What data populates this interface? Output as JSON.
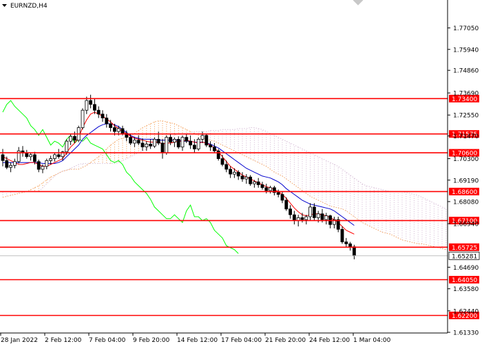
{
  "header": {
    "symbol": "EURNZD,H4",
    "menu_icon": "triangle-down-icon",
    "corner_icon": "chevron-down-icon"
  },
  "chart_data": {
    "type": "candlestick",
    "title": "EURNZD,H4",
    "ylim": [
      1.6133,
      1.7835
    ],
    "y_ticks": [
      1.7705,
      1.7594,
      1.7486,
      1.7369,
      1.7255,
      1.7147,
      1.703,
      1.6919,
      1.6808,
      1.6694,
      1.6469,
      1.6358,
      1.6244,
      1.6133
    ],
    "y_tick_labels": [
      "1.77050",
      "1.75940",
      "1.74860",
      "1.73690",
      "1.72550",
      "1.71470",
      "1.70300",
      "1.69190",
      "1.68080",
      "1.66940",
      "1.64690",
      "1.63580",
      "1.62440",
      "1.61330"
    ],
    "x_tick_labels": [
      "28 Jan 2022",
      "2 Feb 12:00",
      "7 Feb 04:00",
      "9 Feb 20:00",
      "14 Feb 12:00",
      "17 Feb 04:00",
      "21 Feb 20:00",
      "24 Feb 12:00",
      "1 Mar 04:00"
    ],
    "levels": [
      {
        "label": "1.73400",
        "value": 1.734
      },
      {
        "label": "1.71575",
        "value": 1.71575
      },
      {
        "label": "1.70600",
        "value": 1.706
      },
      {
        "label": "1.68600",
        "value": 1.686
      },
      {
        "label": "1.67100",
        "value": 1.671
      },
      {
        "label": "1.65725",
        "value": 1.65725
      },
      {
        "label": "1.64050",
        "value": 1.6405
      },
      {
        "label": "1.62200",
        "value": 1.622
      }
    ],
    "current_price": {
      "label": "1.65281",
      "value": 1.65281
    },
    "candles": [
      [
        1.705,
        1.708,
        1.699,
        1.702
      ],
      [
        1.702,
        1.704,
        1.6975,
        1.6985
      ],
      [
        1.6985,
        1.701,
        1.696,
        1.6995
      ],
      [
        1.6995,
        1.703,
        1.698,
        1.7015
      ],
      [
        1.7015,
        1.709,
        1.7005,
        1.707
      ],
      [
        1.707,
        1.7095,
        1.704,
        1.706
      ],
      [
        1.706,
        1.7075,
        1.703,
        1.704
      ],
      [
        1.704,
        1.706,
        1.702,
        1.705
      ],
      [
        1.705,
        1.7065,
        1.7,
        1.7015
      ],
      [
        1.7015,
        1.7025,
        1.696,
        1.6975
      ],
      [
        1.6975,
        1.7,
        1.6955,
        1.699
      ],
      [
        1.699,
        1.703,
        1.6975,
        1.702
      ],
      [
        1.702,
        1.7045,
        1.7,
        1.703
      ],
      [
        1.703,
        1.706,
        1.7015,
        1.705
      ],
      [
        1.705,
        1.708,
        1.703,
        1.704
      ],
      [
        1.704,
        1.707,
        1.702,
        1.7065
      ],
      [
        1.7065,
        1.713,
        1.705,
        1.712
      ],
      [
        1.712,
        1.716,
        1.71,
        1.7145
      ],
      [
        1.7145,
        1.717,
        1.711,
        1.7125
      ],
      [
        1.7125,
        1.72,
        1.7115,
        1.719
      ],
      [
        1.719,
        1.729,
        1.718,
        1.728
      ],
      [
        1.728,
        1.735,
        1.726,
        1.733
      ],
      [
        1.733,
        1.736,
        1.729,
        1.731
      ],
      [
        1.731,
        1.734,
        1.726,
        1.728
      ],
      [
        1.728,
        1.73,
        1.724,
        1.726
      ],
      [
        1.726,
        1.728,
        1.722,
        1.724
      ],
      [
        1.724,
        1.726,
        1.719,
        1.721
      ],
      [
        1.721,
        1.723,
        1.717,
        1.719
      ],
      [
        1.719,
        1.721,
        1.715,
        1.717
      ],
      [
        1.717,
        1.72,
        1.715,
        1.7185
      ],
      [
        1.7185,
        1.72,
        1.715,
        1.716
      ],
      [
        1.716,
        1.7175,
        1.712,
        1.714
      ],
      [
        1.714,
        1.716,
        1.71,
        1.711
      ],
      [
        1.711,
        1.714,
        1.709,
        1.7125
      ],
      [
        1.7125,
        1.715,
        1.71,
        1.711
      ],
      [
        1.711,
        1.7135,
        1.707,
        1.709
      ],
      [
        1.709,
        1.712,
        1.707,
        1.7105
      ],
      [
        1.7105,
        1.713,
        1.708,
        1.7095
      ],
      [
        1.7095,
        1.714,
        1.7085,
        1.713
      ],
      [
        1.713,
        1.717,
        1.71,
        1.711
      ],
      [
        1.711,
        1.713,
        1.703,
        1.706
      ],
      [
        1.706,
        1.715,
        1.705,
        1.714
      ],
      [
        1.714,
        1.716,
        1.71,
        1.7115
      ],
      [
        1.7115,
        1.714,
        1.709,
        1.713
      ],
      [
        1.713,
        1.7145,
        1.708,
        1.709
      ],
      [
        1.709,
        1.715,
        1.707,
        1.714
      ],
      [
        1.714,
        1.716,
        1.711,
        1.712
      ],
      [
        1.712,
        1.715,
        1.708,
        1.71
      ],
      [
        1.71,
        1.713,
        1.706,
        1.708
      ],
      [
        1.708,
        1.714,
        1.707,
        1.713
      ],
      [
        1.713,
        1.717,
        1.711,
        1.715
      ],
      [
        1.715,
        1.716,
        1.709,
        1.71
      ],
      [
        1.71,
        1.712,
        1.707,
        1.709
      ],
      [
        1.709,
        1.711,
        1.706,
        1.707
      ],
      [
        1.707,
        1.708,
        1.702,
        1.703
      ],
      [
        1.703,
        1.705,
        1.699,
        1.7
      ],
      [
        1.7,
        1.702,
        1.696,
        1.6975
      ],
      [
        1.6975,
        1.699,
        1.693,
        1.695
      ],
      [
        1.695,
        1.698,
        1.693,
        1.696
      ],
      [
        1.696,
        1.697,
        1.692,
        1.694
      ],
      [
        1.694,
        1.696,
        1.691,
        1.6925
      ],
      [
        1.6925,
        1.695,
        1.69,
        1.6935
      ],
      [
        1.6935,
        1.6945,
        1.689,
        1.69
      ],
      [
        1.69,
        1.692,
        1.688,
        1.691
      ],
      [
        1.691,
        1.693,
        1.688,
        1.6895
      ],
      [
        1.6895,
        1.691,
        1.687,
        1.688
      ],
      [
        1.688,
        1.69,
        1.685,
        1.6865
      ],
      [
        1.6865,
        1.689,
        1.685,
        1.688
      ],
      [
        1.688,
        1.689,
        1.684,
        1.6855
      ],
      [
        1.6855,
        1.687,
        1.683,
        1.6845
      ],
      [
        1.6845,
        1.686,
        1.68,
        1.6815
      ],
      [
        1.6815,
        1.683,
        1.676,
        1.677
      ],
      [
        1.677,
        1.679,
        1.672,
        1.674
      ],
      [
        1.674,
        1.676,
        1.669,
        1.671
      ],
      [
        1.671,
        1.674,
        1.668,
        1.6725
      ],
      [
        1.6725,
        1.675,
        1.67,
        1.6715
      ],
      [
        1.6715,
        1.674,
        1.669,
        1.673
      ],
      [
        1.673,
        1.68,
        1.671,
        1.678
      ],
      [
        1.678,
        1.68,
        1.671,
        1.6725
      ],
      [
        1.6725,
        1.676,
        1.67,
        1.6745
      ],
      [
        1.6745,
        1.677,
        1.67,
        1.6715
      ],
      [
        1.6715,
        1.675,
        1.669,
        1.6735
      ],
      [
        1.6735,
        1.674,
        1.667,
        1.669
      ],
      [
        1.669,
        1.673,
        1.667,
        1.6715
      ],
      [
        1.6715,
        1.673,
        1.665,
        1.6665
      ],
      [
        1.6665,
        1.668,
        1.659,
        1.66
      ],
      [
        1.66,
        1.662,
        1.657,
        1.659
      ],
      [
        1.659,
        1.66,
        1.6555,
        1.6575
      ],
      [
        1.6575,
        1.6585,
        1.651,
        1.6528
      ]
    ],
    "overlays": {
      "tenkan": [
        1.704,
        1.703,
        1.702,
        1.701,
        1.7,
        1.7,
        1.7005,
        1.701,
        1.701,
        1.7,
        1.699,
        1.699,
        1.7,
        1.701,
        1.702,
        1.703,
        1.706,
        1.709,
        1.711,
        1.714,
        1.719,
        1.723,
        1.726,
        1.727,
        1.726,
        1.725,
        1.7235,
        1.722,
        1.72,
        1.7185,
        1.717,
        1.716,
        1.7145,
        1.7135,
        1.713,
        1.7125,
        1.712,
        1.7115,
        1.7115,
        1.7115,
        1.7105,
        1.711,
        1.711,
        1.7115,
        1.712,
        1.712,
        1.7125,
        1.712,
        1.7115,
        1.711,
        1.7115,
        1.711,
        1.71,
        1.7085,
        1.7065,
        1.704,
        1.7015,
        1.699,
        1.6975,
        1.696,
        1.6945,
        1.6935,
        1.6925,
        1.6915,
        1.6905,
        1.6895,
        1.6885,
        1.688,
        1.687,
        1.686,
        1.6845,
        1.6825,
        1.68,
        1.6775,
        1.6755,
        1.674,
        1.6735,
        1.674,
        1.6745,
        1.6745,
        1.674,
        1.6735,
        1.6725,
        1.6715,
        1.67,
        1.668,
        1.666,
        1.665,
        1.664
      ],
      "kijun": [
        1.701,
        1.701,
        1.701,
        1.701,
        1.701,
        1.701,
        1.701,
        1.701,
        1.701,
        1.701,
        1.7005,
        1.7005,
        1.7005,
        1.7005,
        1.701,
        1.702,
        1.704,
        1.706,
        1.708,
        1.71,
        1.713,
        1.715,
        1.7165,
        1.718,
        1.7195,
        1.7205,
        1.721,
        1.721,
        1.7205,
        1.7195,
        1.718,
        1.7165,
        1.715,
        1.714,
        1.7135,
        1.713,
        1.713,
        1.713,
        1.713,
        1.7125,
        1.7125,
        1.7125,
        1.7125,
        1.7125,
        1.7125,
        1.712,
        1.712,
        1.712,
        1.7115,
        1.7115,
        1.7115,
        1.711,
        1.7105,
        1.7095,
        1.7085,
        1.707,
        1.7055,
        1.704,
        1.7025,
        1.701,
        1.6995,
        1.698,
        1.697,
        1.696,
        1.695,
        1.694,
        1.6935,
        1.693,
        1.692,
        1.691,
        1.6895,
        1.6875,
        1.686,
        1.6845,
        1.683,
        1.6815,
        1.6805,
        1.6795,
        1.679,
        1.6785,
        1.678,
        1.6775,
        1.677,
        1.676,
        1.6745,
        1.673,
        1.6715,
        1.67,
        1.6685
      ],
      "chikou": [
        1.727,
        1.731,
        1.733,
        1.73,
        1.728,
        1.726,
        1.724,
        1.72,
        1.718,
        1.715,
        1.718,
        1.714,
        1.71,
        1.712,
        1.711,
        1.709,
        1.713,
        1.715,
        1.711,
        1.713,
        1.712,
        1.714,
        1.711,
        1.71,
        1.709,
        1.708,
        1.705,
        1.702,
        1.701,
        1.702,
        1.7,
        1.696,
        1.694,
        1.691,
        1.689,
        1.687,
        1.685,
        1.682,
        1.678,
        1.676,
        1.674,
        1.672,
        1.672,
        1.674,
        1.672,
        1.67,
        1.676,
        1.679,
        1.673,
        1.673,
        1.671,
        1.672,
        1.67,
        1.666,
        1.664,
        1.662,
        1.658,
        1.657,
        1.656,
        1.654
      ],
      "span_a": [
        1.683,
        1.6835,
        1.684,
        1.6845,
        1.685,
        1.6855,
        1.686,
        1.687,
        1.688,
        1.689,
        1.6905,
        1.692,
        1.6935,
        1.6945,
        1.6955,
        1.6965,
        1.697,
        1.6975,
        1.6975,
        1.6975,
        1.6985,
        1.6995,
        1.701,
        1.7025,
        1.704,
        1.706,
        1.708,
        1.71,
        1.7115,
        1.713,
        1.7135,
        1.714,
        1.715,
        1.716,
        1.7175,
        1.719,
        1.72,
        1.721,
        1.722,
        1.7225,
        1.7225,
        1.722,
        1.7215,
        1.721,
        1.72,
        1.719,
        1.718,
        1.717,
        1.716,
        1.715,
        1.714,
        1.713,
        1.7125,
        1.712,
        1.711,
        1.71,
        1.709,
        1.708,
        1.707,
        1.706,
        1.705,
        1.704,
        1.703,
        1.702,
        1.701,
        1.7,
        1.699,
        1.6975,
        1.696,
        1.695,
        1.694,
        1.6925,
        1.691,
        1.6895,
        1.688,
        1.6865,
        1.685,
        1.6835,
        1.6825,
        1.6815,
        1.6805,
        1.6795,
        1.6785,
        1.678,
        1.6775,
        1.677,
        1.676,
        1.6745,
        1.673,
        1.6715,
        1.67,
        1.669,
        1.668,
        1.667,
        1.666,
        1.665,
        1.6645,
        1.664,
        1.663,
        1.662,
        1.661,
        1.6605,
        1.66,
        1.6595,
        1.659,
        1.659,
        1.6585,
        1.658,
        1.6575,
        1.657,
        1.6565,
        1.656,
        1.6555,
        1.655
      ],
      "span_b": [
        1.686,
        1.686,
        1.686,
        1.686,
        1.686,
        1.686,
        1.686,
        1.686,
        1.686,
        1.686,
        1.688,
        1.69,
        1.692,
        1.694,
        1.6955,
        1.6965,
        1.697,
        1.698,
        1.699,
        1.7,
        1.7005,
        1.7005,
        1.7005,
        1.7005,
        1.7005,
        1.7005,
        1.7005,
        1.7005,
        1.7005,
        1.701,
        1.702,
        1.703,
        1.704,
        1.705,
        1.706,
        1.707,
        1.708,
        1.709,
        1.71,
        1.711,
        1.712,
        1.713,
        1.714,
        1.715,
        1.716,
        1.716,
        1.716,
        1.7165,
        1.717,
        1.717,
        1.717,
        1.717,
        1.7175,
        1.7175,
        1.7175,
        1.718,
        1.718,
        1.718,
        1.718,
        1.7185,
        1.7185,
        1.7185,
        1.719,
        1.719,
        1.7185,
        1.718,
        1.717,
        1.716,
        1.715,
        1.714,
        1.713,
        1.712,
        1.711,
        1.71,
        1.709,
        1.708,
        1.707,
        1.706,
        1.705,
        1.704,
        1.703,
        1.702,
        1.701,
        1.7,
        1.699,
        1.6975,
        1.696,
        1.6945,
        1.693,
        1.6915,
        1.69,
        1.689,
        1.6885,
        1.688,
        1.6875,
        1.687,
        1.6865,
        1.686,
        1.686,
        1.686,
        1.686,
        1.6855,
        1.685,
        1.6845,
        1.684,
        1.683,
        1.682,
        1.681,
        1.68,
        1.679,
        1.678,
        1.677,
        1.676
      ]
    },
    "grid": false,
    "colors": {
      "background": "#ffffff",
      "candle": "#000000",
      "level_line": "#ff0000",
      "level_label_bg": "#ff0000",
      "tenkan": "#ff0000",
      "kijun": "#0000cd",
      "chikou": "#00ff00",
      "cloud_bull": "#f4a460",
      "cloud_bear": "#d8bfd8",
      "current_price_line": "#c0c0c0"
    }
  }
}
